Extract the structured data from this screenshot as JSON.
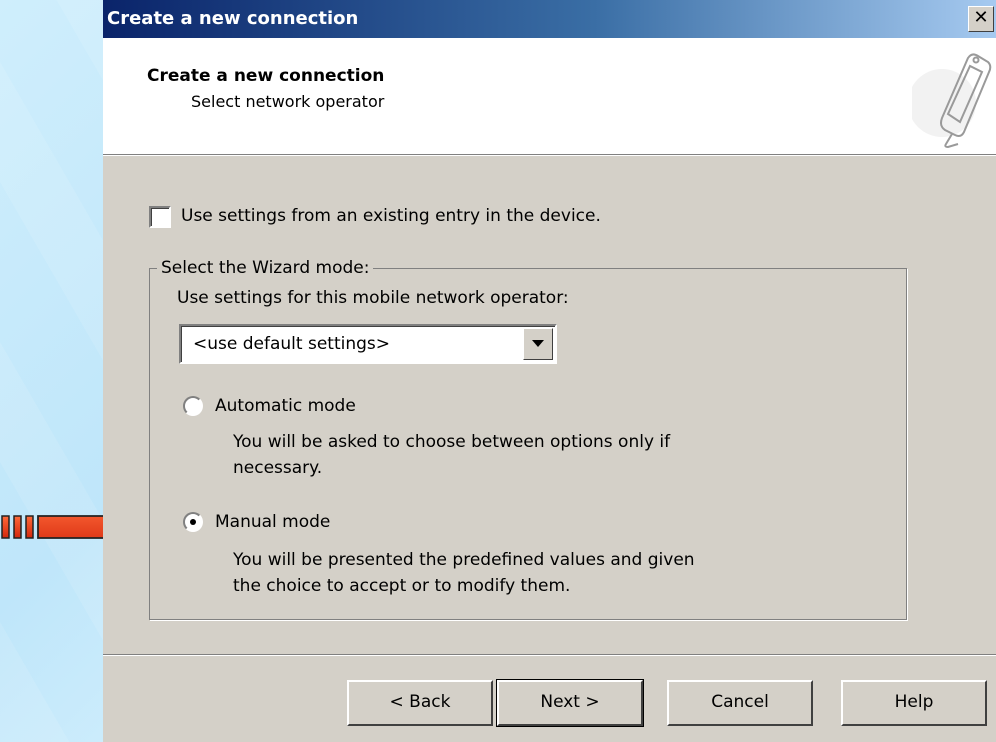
{
  "window": {
    "title": "Create a new connection",
    "close_glyph": "✕"
  },
  "header": {
    "title": "Create a new connection",
    "subtitle": "Select network operator",
    "icon": "mobile-phone-icon"
  },
  "options": {
    "use_existing_label": "Use settings from an existing entry in the device.",
    "use_existing_checked": false
  },
  "wizard": {
    "group_label": "Select the Wizard mode:",
    "operator_label": "Use settings for this mobile network operator:",
    "operator_selected": "<use default settings>",
    "automatic": {
      "label": "Automatic mode",
      "description_line1": "You will be asked to choose between options only if",
      "description_line2": "necessary.",
      "selected": false
    },
    "manual": {
      "label": "Manual mode",
      "description_line1": "You will be presented the predefined values and given",
      "description_line2": "the choice to accept or to modify them.",
      "selected": true
    }
  },
  "buttons": {
    "back": "< Back",
    "next": "Next >",
    "cancel": "Cancel",
    "help": "Help"
  },
  "annotation": {
    "arrow_color": "#e8391a",
    "arrow_icon": "right-arrow-icon"
  }
}
